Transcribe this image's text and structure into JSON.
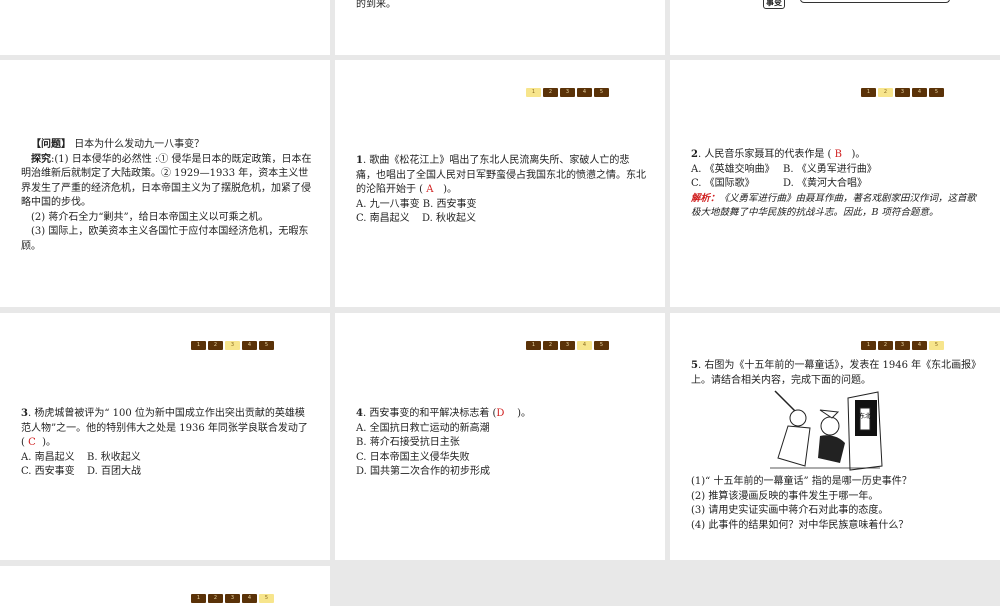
{
  "top_row": {
    "p2_text": "的到来。",
    "p3_box": "事变"
  },
  "nav": [
    "1",
    "2",
    "3",
    "4",
    "5"
  ],
  "problem": {
    "heading": "【问题】",
    "question": "日本为什么发动九一八事变？",
    "explore_label": "探究",
    "p1": ":(1) 日本侵华的必然性 :① 侵华是日本的既定政策，日本在明治维新后就制定了大陆政策。② 1929—1933 年，资本主义世界发生了严重的经济危机，日本帝国主义为了摆脱危机，加紧了侵略中国的步伐。",
    "p2": "(2) 蒋介石全力“剿共”，给日本帝国主义以可乘之机。",
    "p3": "(3) 国际上，欧美资本主义各国忙于应付本国经济危机，无暇东顾。"
  },
  "q1": {
    "num": "1",
    "stem": ". 歌曲《松花江上》唱出了东北人民流离失所、家破人亡的悲痛，也唱出了全国人民对日军野蛮侵占我国东北的愤懑之情。东北的沦陷开始于 (",
    "answer": "A",
    "close": ")。",
    "options": [
      "A. 九一八事变",
      "B. 西安事变",
      "C. 南昌起义",
      "D. 秋收起义"
    ]
  },
  "q2": {
    "num": "2",
    "stem": ". 人民音乐家聂耳的代表作是 (",
    "answer": "B",
    "close": ")。",
    "options": [
      "A. 《英雄交响曲》",
      "B. 《义勇军进行曲》",
      "C. 《国际歌》",
      "D. 《黄河大合唱》"
    ],
    "analysis_label": "解析：",
    "analysis": "《义勇军进行曲》由聂耳作曲，著名戏剧家田汉作词，这首歌极大地鼓舞了中华民族的抗战斗志。因此，B 项符合题意。"
  },
  "q3": {
    "num": "3",
    "stem": ". 杨虎城曾被评为“ 100 位为新中国成立作出突出贡献的英雄模范人物”之一。他的特别伟大之处是 1936 年同张学良联合发动了 (",
    "answer": "C",
    "close": ")。",
    "options": [
      "A. 南昌起义",
      "B. 秋收起义",
      "C. 西安事变",
      "D. 百团大战"
    ]
  },
  "q4": {
    "num": "4",
    "stem": ". 西安事变的和平解决标志着 (",
    "answer": "D",
    "close": ")。",
    "options": [
      "A. 全国抗日救亡运动的新高潮",
      "B. 蒋介石接受抗日主张",
      "C. 日本帝国主义侵华失败",
      "D. 国共第二次合作的初步形成"
    ]
  },
  "q5": {
    "num": "5",
    "stem": ". 右图为《十五年前的一幕童话》，发表在 1946 年《东北画报》上。请结合相关内容，完成下面的问题。",
    "sub": [
      "(1)“ 十五年前的一幕童话” 指的是哪一历史事件？",
      "(2) 推算该漫画反映的事件发生于哪一年。",
      "(3) 请用史实证实画中蒋介石对此事的态度。",
      "(4) 此事件的结果如何？对中华民族意味着什么？"
    ],
    "cartoon_text": "东北"
  }
}
